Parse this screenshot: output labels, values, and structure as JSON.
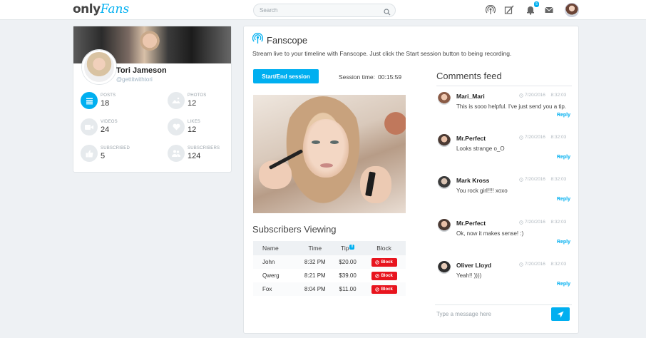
{
  "header": {
    "logo_only": "only",
    "logo_fans": "Fans",
    "search_placeholder": "Search",
    "notification_badge": "5"
  },
  "profile": {
    "name": "Tori Jameson",
    "handle": "@gettitwithtori",
    "stats": [
      {
        "label": "Posts",
        "value": "18",
        "icon": "list-icon",
        "active": true
      },
      {
        "label": "Photos",
        "value": "12",
        "icon": "image-icon",
        "active": false
      },
      {
        "label": "Videos",
        "value": "24",
        "icon": "video-icon",
        "active": false
      },
      {
        "label": "Likes",
        "value": "12",
        "icon": "heart-icon",
        "active": false
      },
      {
        "label": "Subscribed",
        "value": "5",
        "icon": "thumbs-up-icon",
        "active": false
      },
      {
        "label": "Subscribers",
        "value": "124",
        "icon": "users-icon",
        "active": false
      }
    ]
  },
  "fanscope": {
    "title": "Fanscope",
    "description": "Stream live to your timeline with Fanscope. Just click the Start session button to being recording.",
    "session_button": "Start/End session",
    "session_time_label": "Session time:",
    "session_time_value": "00:15:59"
  },
  "subscribers": {
    "title": "Subscribers Viewing",
    "columns": {
      "name": "Name",
      "time": "Time",
      "tip": "Tip",
      "tip_badge": "8",
      "block": "Block"
    },
    "rows": [
      {
        "name": "John",
        "time": "8:32 PM",
        "tip": "$20.00",
        "block": "Block"
      },
      {
        "name": "Qwerg",
        "time": "8:21 PM",
        "tip": "$39.00",
        "block": "Block"
      },
      {
        "name": "Fox",
        "time": "8:04 PM",
        "tip": "$11.00",
        "block": "Block"
      }
    ]
  },
  "comments": {
    "title": "Comments feed",
    "items": [
      {
        "name": "Mari_Mari",
        "date": "7/20/2016",
        "time": "8:32:03",
        "text": "This is sooo helpful. I've just send you a tip.",
        "reply": "Reply"
      },
      {
        "name": "Mr.Perfect",
        "date": "7/20/2016",
        "time": "8:32:03",
        "text": "Looks strange  o_O",
        "reply": "Reply"
      },
      {
        "name": "Mark Kross",
        "date": "7/20/2016",
        "time": "8:32:03",
        "text": "You rock girl!!!!  xoxo",
        "reply": "Reply"
      },
      {
        "name": "Mr.Perfect",
        "date": "7/20/2016",
        "time": "8:32:03",
        "text": "Ok, now it makes sense! :)",
        "reply": "Reply"
      },
      {
        "name": "Oliver Lloyd",
        "date": "7/20/2016",
        "time": "8:32:03",
        "text": "Yeah!! ))))",
        "reply": "Reply"
      }
    ],
    "message_placeholder": "Type a message here"
  },
  "colors": {
    "accent": "#00aff0",
    "block": "#e8141e"
  }
}
